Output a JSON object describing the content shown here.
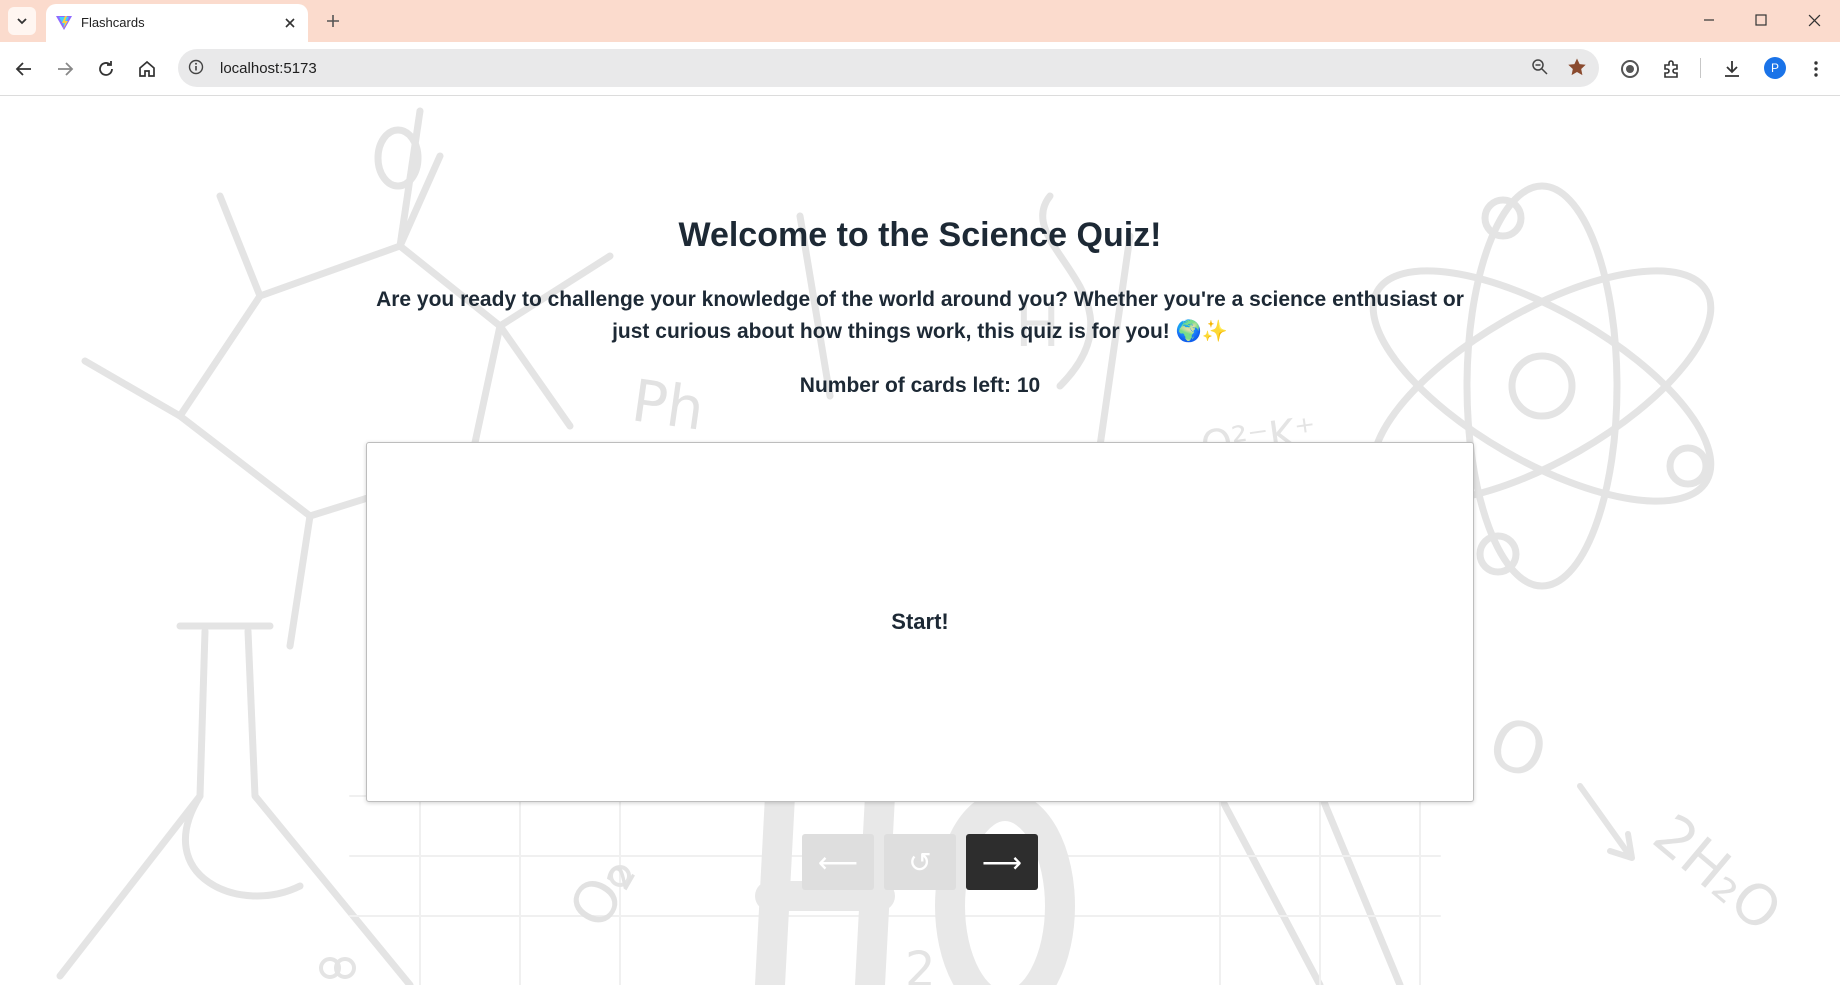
{
  "browser": {
    "tab_title": "Flashcards",
    "url": "localhost:5173",
    "profile_initial": "P"
  },
  "page": {
    "heading": "Welcome to the Science Quiz!",
    "intro": "Are you ready to challenge your knowledge of the world around you? Whether you're a science enthusiast or just curious about how things work, this quiz is for you! 🌍✨",
    "cards_left_label": "Number of cards left: 10",
    "card_text": "Start!",
    "controls": {
      "prev": "⟵",
      "flip": "↺",
      "next": "⟶"
    }
  },
  "background_art": [
    "Ph",
    "H",
    "2",
    "O",
    "O₂",
    "2H₂O",
    "O²⁻K⁺"
  ],
  "colors": {
    "tab_strip": "#fbdbcd",
    "text": "#1d2935",
    "next_button": "#2d2d2d",
    "disabled_button": "#dedede"
  },
  "icons": [
    "tab-search-icon",
    "vite-favicon-icon",
    "close-icon",
    "plus-icon",
    "minimize-icon",
    "maximize-icon",
    "back-icon",
    "forward-icon",
    "reload-icon",
    "home-icon",
    "info-icon",
    "zoom-icon",
    "star-icon",
    "password-manager-icon",
    "extensions-icon",
    "download-icon",
    "more-icon"
  ]
}
